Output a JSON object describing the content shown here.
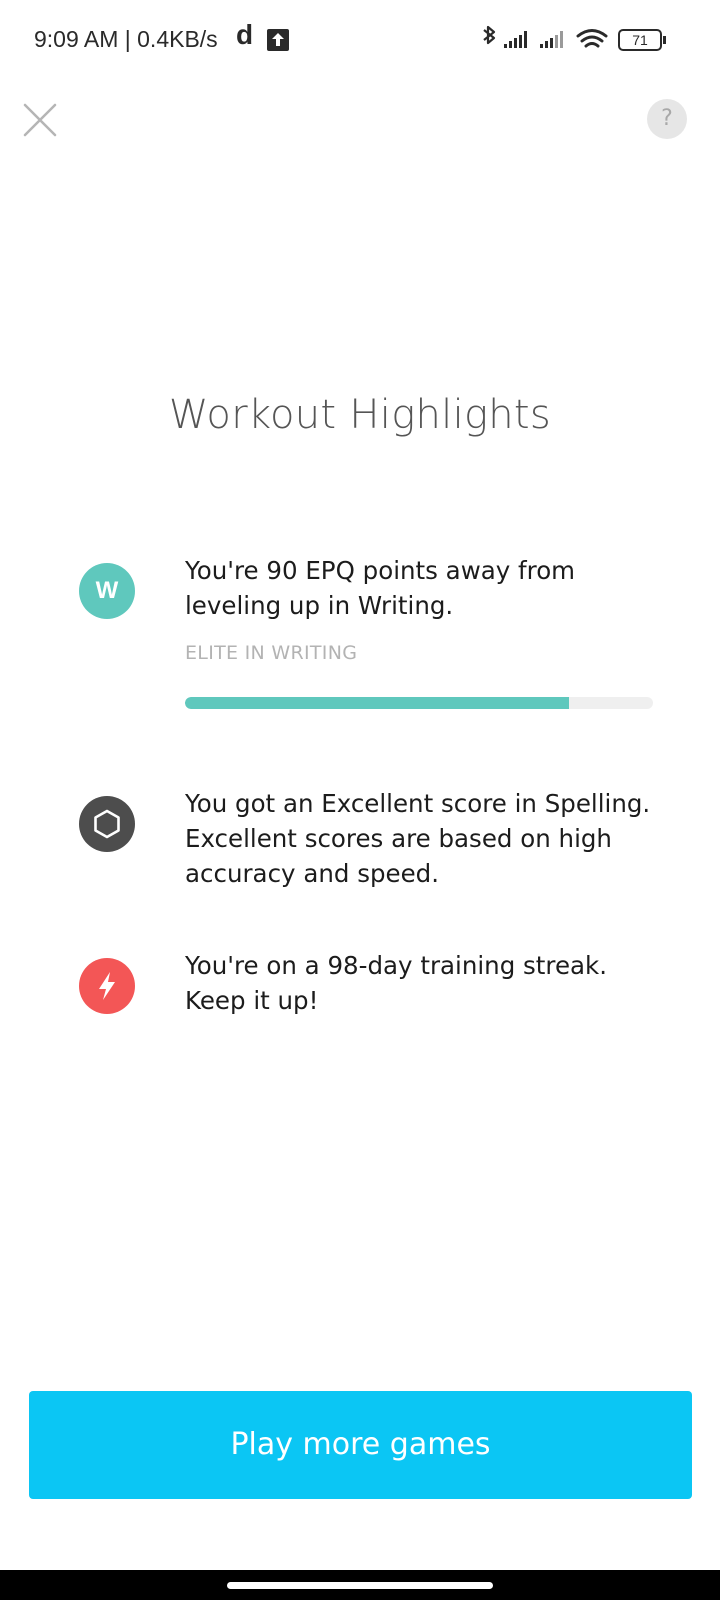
{
  "status_bar": {
    "time_text": "9:09 AM | 0.4KB/s",
    "app_glyph": "d",
    "upload_icon": "upload-arrow-icon",
    "battery_level": "71",
    "icons": [
      "bluetooth-icon",
      "signal-icon",
      "signal-icon",
      "wifi-icon",
      "battery-icon"
    ]
  },
  "top_bar": {
    "close_icon": "close-icon",
    "help_label": "?"
  },
  "page": {
    "title": "Workout Highlights"
  },
  "highlights": [
    {
      "icon_letter": "W",
      "icon_color": "#5fc8bd",
      "text": "You're 90 EPQ points away from leveling up in Writing.",
      "progress_label": "ELITE IN WRITING",
      "progress_fraction": 0.82
    },
    {
      "icon": "hexagon-icon",
      "icon_color": "#4d4d4d",
      "text": "You got an Excellent score in Spelling. Excellent scores are based on high accuracy and speed."
    },
    {
      "icon": "lightning-icon",
      "icon_color": "#f35656",
      "text": "You're on a 98-day training streak. Keep it up!"
    }
  ],
  "cta": {
    "label": "Play more games",
    "color": "#0bc6f4"
  }
}
